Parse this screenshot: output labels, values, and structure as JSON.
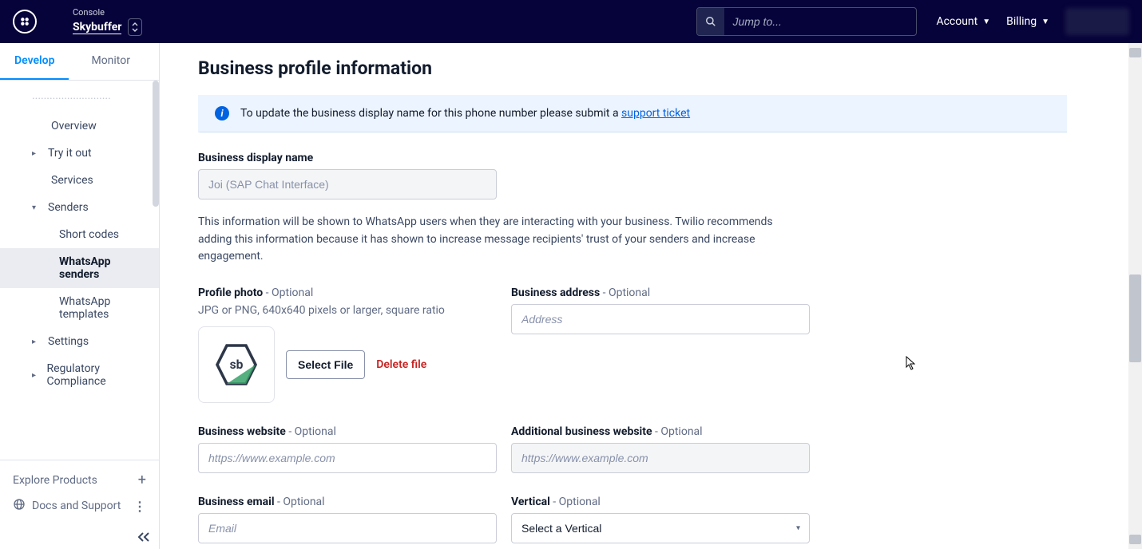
{
  "topbar": {
    "console_label": "Console",
    "project_name": "Skybuffer",
    "search_placeholder": "Jump to...",
    "account_label": "Account",
    "billing_label": "Billing"
  },
  "sidebar": {
    "tabs": {
      "develop": "Develop",
      "monitor": "Monitor"
    },
    "items": {
      "overview": "Overview",
      "try_it": "Try it out",
      "services": "Services",
      "senders": "Senders",
      "short_codes": "Short codes",
      "whatsapp_senders": "WhatsApp senders",
      "whatsapp_templates": "WhatsApp templates",
      "settings": "Settings",
      "regulatory": "Regulatory Compliance"
    },
    "explore": "Explore Products",
    "docs": "Docs and Support"
  },
  "page": {
    "title": "Business profile information",
    "banner_text": "To update the business display name for this phone number please submit a ",
    "banner_link": "support ticket",
    "bdn_label": "Business display name",
    "bdn_value": "Joi (SAP Chat Interface)",
    "desc": "This information will be shown to WhatsApp users when they are interacting with your business. Twilio recommends adding this information because it has shown to increase message recipients' trust of your senders and increase engagement.",
    "profile_photo_label": "Profile photo",
    "optional": " - Optional",
    "photo_hint": "JPG or PNG, 640x640 pixels or larger, square ratio",
    "select_file": "Select File",
    "delete_file": "Delete file",
    "address_label": "Business address",
    "address_placeholder": "Address",
    "website_label": "Business website",
    "website_placeholder": "https://www.example.com",
    "addl_website_label": "Additional business website",
    "addl_website_placeholder": "https://www.example.com",
    "email_label": "Business email",
    "email_placeholder": "Email",
    "vertical_label": "Vertical",
    "vertical_value": "Select a Vertical"
  }
}
